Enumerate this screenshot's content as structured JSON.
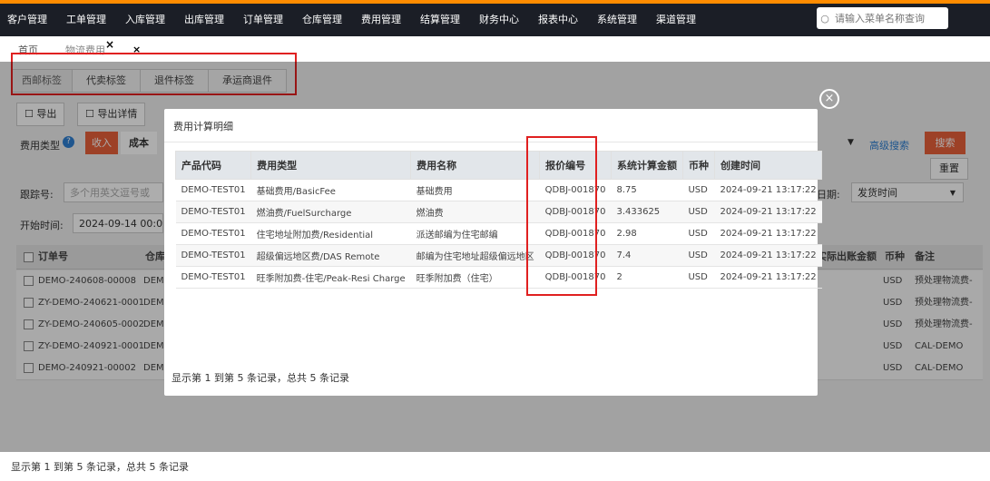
{
  "nav": {
    "items": [
      "客户管理",
      "工单管理",
      "入库管理",
      "出库管理",
      "订单管理",
      "仓库管理",
      "费用管理",
      "结算管理",
      "财务中心",
      "报表中心",
      "系统管理",
      "渠道管理"
    ],
    "search_placeholder": "请输入菜单名称查询"
  },
  "tabs": {
    "home": "首页",
    "current": "物流费用",
    "close": "×"
  },
  "subtabs": [
    "西邮标签",
    "代卖标签",
    "退件标签",
    "承运商退件"
  ],
  "toolbar": {
    "export": "导出",
    "export_detail": "导出详情"
  },
  "filters": {
    "fee_type_label": "费用类型",
    "income": "收入",
    "cost": "成本",
    "advanced_search": "高级搜索",
    "search": "搜索",
    "reset": "重置",
    "tracking_label": "跟踪号:",
    "tracking_placeholder": "多个用英文逗号或",
    "date_label": "日期:",
    "date_value": "发货时间",
    "start_label": "开始时间:",
    "start_value": "2024-09-14 00:0"
  },
  "bg_table": {
    "headers": {
      "order": "订单号",
      "warehouse": "仓库",
      "actual": "实际出账金额",
      "currency": "币种",
      "remark": "备注"
    },
    "rows": [
      {
        "order": "DEMO-240608-00008",
        "wh": "DEMO",
        "currency": "USD",
        "remark": "预处理物流费-"
      },
      {
        "order": "ZY-DEMO-240621-0001",
        "wh": "DEMO",
        "currency": "USD",
        "remark": "预处理物流费-"
      },
      {
        "order": "ZY-DEMO-240605-0002",
        "wh": "DEMO",
        "currency": "USD",
        "remark": "预处理物流费-"
      },
      {
        "order": "ZY-DEMO-240921-0001",
        "wh": "DEMO",
        "currency": "USD",
        "remark": "CAL-DEMO"
      },
      {
        "order": "DEMO-240921-00002",
        "wh": "DEMO",
        "currency": "USD",
        "remark": "CAL-DEMO"
      }
    ]
  },
  "footer": "显示第 1 到第 5 条记录，总共 5 条记录",
  "modal": {
    "title": "费用计算明细",
    "headers": [
      "产品代码",
      "费用类型",
      "费用名称",
      "报价编号",
      "系统计算金额",
      "币种",
      "创建时间"
    ],
    "rows": [
      [
        "DEMO-TEST01",
        "基础费用/BasicFee",
        "基础费用",
        "QDBJ-001870",
        "8.75",
        "USD",
        "2024-09-21 13:17:22"
      ],
      [
        "DEMO-TEST01",
        "燃油费/FuelSurcharge",
        "燃油费",
        "QDBJ-001870",
        "3.433625",
        "USD",
        "2024-09-21 13:17:22"
      ],
      [
        "DEMO-TEST01",
        "住宅地址附加费/Residential",
        "派送邮编为住宅邮编",
        "QDBJ-001870",
        "2.98",
        "USD",
        "2024-09-21 13:17:22"
      ],
      [
        "DEMO-TEST01",
        "超级偏远地区费/DAS Remote",
        "邮编为住宅地址超级偏远地区",
        "QDBJ-001870",
        "7.4",
        "USD",
        "2024-09-21 13:17:22"
      ],
      [
        "DEMO-TEST01",
        "旺季附加费-住宅/Peak-Resi Charge",
        "旺季附加费（住宅）",
        "QDBJ-001870",
        "2",
        "USD",
        "2024-09-21 13:17:22"
      ]
    ],
    "footer": "显示第 1 到第 5 条记录，总共 5 条记录"
  },
  "colors": {
    "topbar": "#1b1e26",
    "accent_orange": "#e8613a",
    "highlight_red": "#e02020"
  }
}
